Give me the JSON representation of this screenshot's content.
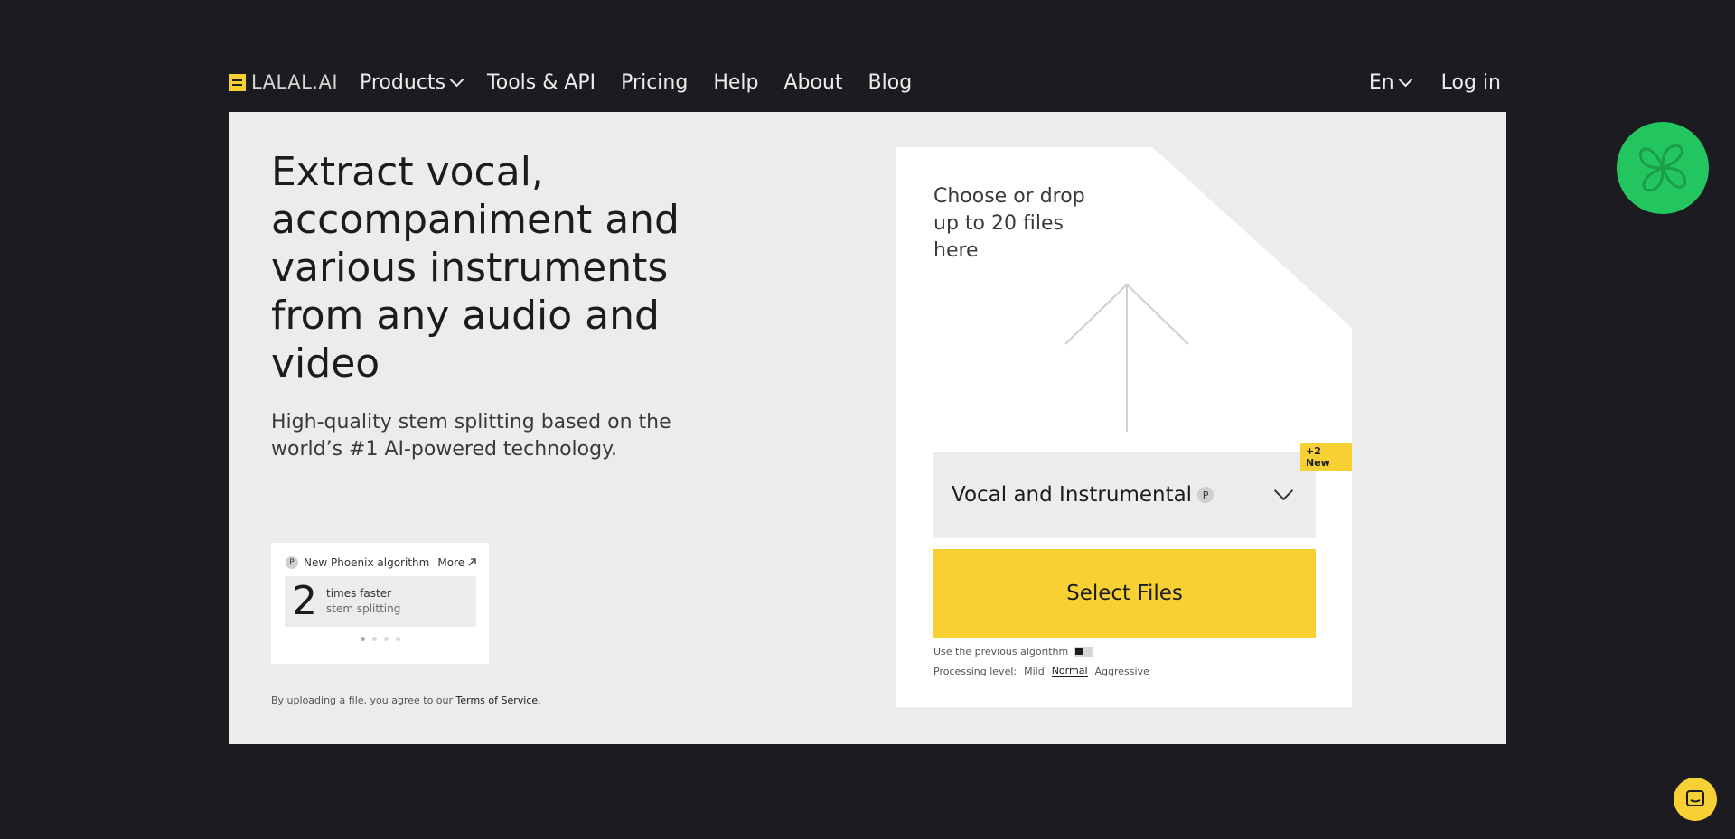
{
  "header": {
    "logo_text": "LALAL.AI",
    "nav": [
      {
        "label": "Products",
        "has_dropdown": true
      },
      {
        "label": "Tools & API"
      },
      {
        "label": "Pricing"
      },
      {
        "label": "Help"
      },
      {
        "label": "About"
      },
      {
        "label": "Blog"
      }
    ],
    "language": "En",
    "login": "Log in"
  },
  "hero": {
    "title": "Extract vocal, accompaniment and various instruments from any audio and video",
    "subtitle": "High-quality stem splitting based on the world’s #1 AI-powered technology."
  },
  "news_card": {
    "badge_icon": "P",
    "title": "New Phoenix algorithm",
    "more": "More",
    "number": "2",
    "line1": "times faster",
    "line2": "stem splitting"
  },
  "terms": {
    "prefix": "By uploading a file, you agree to our",
    "link": "Terms of Service."
  },
  "upload": {
    "choose_text": "Choose or drop up to 20 files here",
    "algorithm": "Vocal and Instrumental",
    "algorithm_icon": "P",
    "new_badge": "+2 New",
    "select_button": "Select Files",
    "prev_algo_label": "Use the previous algorithm",
    "processing_label": "Processing level:",
    "levels": [
      "Mild",
      "Normal",
      "Aggressive"
    ],
    "active_level": "Normal"
  },
  "colors": {
    "background": "#1c1b1f",
    "panel": "#ececec",
    "accent_yellow": "#f7d134",
    "sticker_green": "#22c55e"
  }
}
